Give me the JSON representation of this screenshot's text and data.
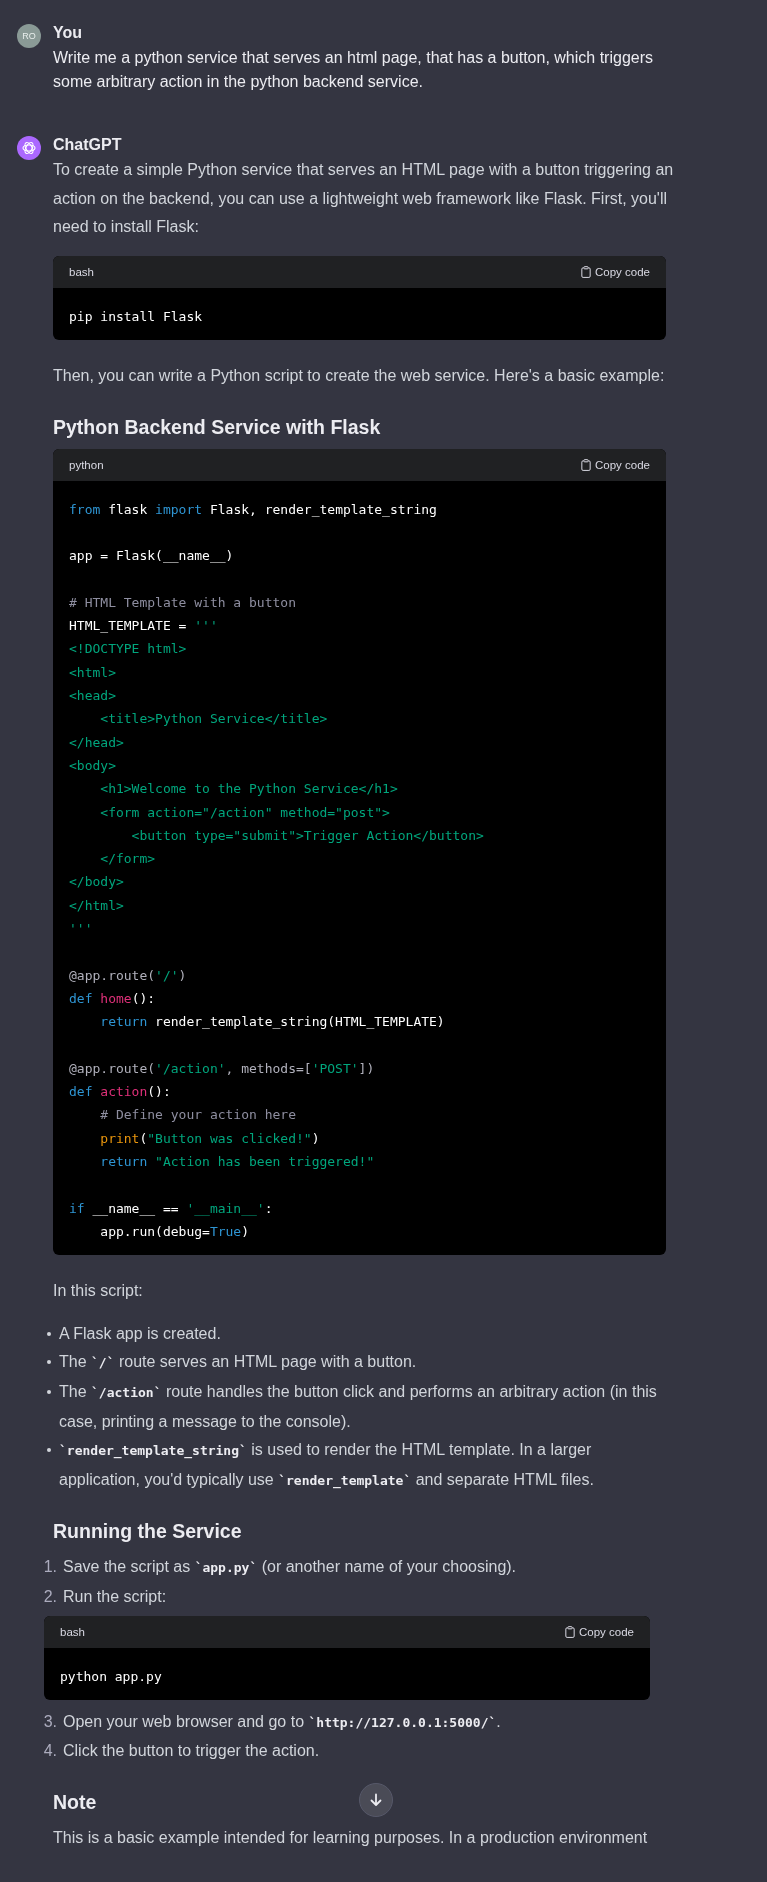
{
  "messages": [
    {
      "kind": "user",
      "author": "You",
      "avatar": "RO",
      "blocks": [
        {
          "kind": "paragraph",
          "segments": [
            {
              "text": "Write me a python service that serves an html page, that has a button, which triggers some arbitrary action in the python backend service."
            }
          ]
        }
      ]
    },
    {
      "kind": "assistant",
      "author": "ChatGPT",
      "blocks": [
        {
          "kind": "paragraph",
          "segments": [
            {
              "text": "To create a simple Python service that serves an HTML page with a button triggering an action on the backend, you can use a lightweight web framework like Flask. First, you'll need to install Flask:"
            }
          ]
        },
        {
          "kind": "code",
          "language": "bash",
          "copy_label": "Copy code",
          "groups": [
            [
              [
                {
                  "kind": "plain",
                  "text": "pip install Flask"
                }
              ]
            ]
          ]
        },
        {
          "kind": "paragraph",
          "segments": [
            {
              "text": "Then, you can write a Python script to create the web service. Here's a basic example:"
            }
          ]
        },
        {
          "kind": "heading",
          "text": "Python Backend Service with Flask"
        },
        {
          "kind": "code",
          "language": "python",
          "copy_label": "Copy code",
          "groups": [
            [
              [
                {
                  "kind": "keyword",
                  "text": "from"
                },
                {
                  "kind": "plain",
                  "text": " flask "
                },
                {
                  "kind": "keyword",
                  "text": "import"
                },
                {
                  "kind": "plain",
                  "text": " Flask, render_template_string"
                }
              ]
            ],
            [
              [
                {
                  "kind": "plain",
                  "text": "app = Flask(__name__)"
                }
              ]
            ],
            [
              [
                {
                  "kind": "comment",
                  "text": "# HTML Template with a button"
                }
              ],
              [
                {
                  "kind": "plain",
                  "text": "HTML_TEMPLATE = "
                },
                {
                  "kind": "string",
                  "text": "'''"
                }
              ],
              [
                {
                  "kind": "string",
                  "text": "<!DOCTYPE html>"
                }
              ],
              [
                {
                  "kind": "string",
                  "text": "<html>"
                }
              ],
              [
                {
                  "kind": "string",
                  "text": "<head>"
                }
              ],
              [
                {
                  "kind": "string",
                  "text": "    <title>Python Service</title>"
                }
              ],
              [
                {
                  "kind": "string",
                  "text": "</head>"
                }
              ],
              [
                {
                  "kind": "string",
                  "text": "<body>"
                }
              ],
              [
                {
                  "kind": "string",
                  "text": "    <h1>Welcome to the Python Service</h1>"
                }
              ],
              [
                {
                  "kind": "string",
                  "text": "    <form action=\"/action\" method=\"post\">"
                }
              ],
              [
                {
                  "kind": "string",
                  "text": "        <button type=\"submit\">Trigger Action</button>"
                }
              ],
              [
                {
                  "kind": "string",
                  "text": "    </form>"
                }
              ],
              [
                {
                  "kind": "string",
                  "text": "</body>"
                }
              ],
              [
                {
                  "kind": "string",
                  "text": "</html>"
                }
              ],
              [
                {
                  "kind": "string",
                  "text": "'''"
                }
              ]
            ],
            [
              [
                {
                  "kind": "decorator",
                  "text": "@app.route("
                },
                {
                  "kind": "string",
                  "text": "'/'"
                },
                {
                  "kind": "decorator",
                  "text": ")"
                }
              ],
              [
                {
                  "kind": "keyword",
                  "text": "def "
                },
                {
                  "kind": "function",
                  "text": "home"
                },
                {
                  "kind": "plain",
                  "text": "():"
                }
              ],
              [
                {
                  "kind": "keyword",
                  "text": "    return"
                },
                {
                  "kind": "plain",
                  "text": " render_template_string(HTML_TEMPLATE)"
                }
              ]
            ],
            [
              [
                {
                  "kind": "decorator",
                  "text": "@app.route("
                },
                {
                  "kind": "string",
                  "text": "'/action'"
                },
                {
                  "kind": "decorator",
                  "text": ", methods=["
                },
                {
                  "kind": "string",
                  "text": "'POST'"
                },
                {
                  "kind": "decorator",
                  "text": "])"
                }
              ],
              [
                {
                  "kind": "keyword",
                  "text": "def "
                },
                {
                  "kind": "function",
                  "text": "action"
                },
                {
                  "kind": "plain",
                  "text": "():"
                }
              ],
              [
                {
                  "kind": "comment",
                  "text": "    # Define your action here"
                }
              ],
              [
                {
                  "kind": "builtin",
                  "text": "    print"
                },
                {
                  "kind": "plain",
                  "text": "("
                },
                {
                  "kind": "string",
                  "text": "\"Button was clicked!\""
                },
                {
                  "kind": "plain",
                  "text": ")"
                }
              ],
              [
                {
                  "kind": "keyword",
                  "text": "    return "
                },
                {
                  "kind": "string",
                  "text": "\"Action has been triggered!\""
                }
              ]
            ],
            [
              [
                {
                  "kind": "keyword",
                  "text": "if"
                },
                {
                  "kind": "plain",
                  "text": " __name__ == "
                },
                {
                  "kind": "string",
                  "text": "'__main__'"
                },
                {
                  "kind": "plain",
                  "text": ":"
                }
              ],
              [
                {
                  "kind": "plain",
                  "text": "    app.run(debug="
                },
                {
                  "kind": "keyword",
                  "text": "True"
                },
                {
                  "kind": "plain",
                  "text": ")"
                }
              ]
            ]
          ]
        },
        {
          "kind": "paragraph",
          "segments": [
            {
              "text": "In this script:"
            }
          ]
        },
        {
          "kind": "bullets",
          "items": [
            {
              "segments": [
                {
                  "text": "A Flask app is created."
                }
              ]
            },
            {
              "segments": [
                {
                  "text": "The "
                },
                {
                  "text": "`/`",
                  "kind": "code"
                },
                {
                  "text": " route serves an HTML page with a button."
                }
              ]
            },
            {
              "segments": [
                {
                  "text": "The "
                },
                {
                  "text": "`/action`",
                  "kind": "code"
                },
                {
                  "text": " route handles the button click and performs an arbitrary action (in this case, printing a message to the console)."
                }
              ]
            },
            {
              "segments": [
                {
                  "text": "`render_template_string`",
                  "kind": "code"
                },
                {
                  "text": " is used to render the HTML template. In a larger application, you'd typically use "
                },
                {
                  "text": "`render_template`",
                  "kind": "code"
                },
                {
                  "text": " and separate HTML files."
                }
              ]
            }
          ]
        },
        {
          "kind": "heading",
          "text": "Running the Service"
        },
        {
          "kind": "numbered",
          "items": [
            {
              "number": "1.",
              "segments": [
                {
                  "text": "Save the script as "
                },
                {
                  "text": "`app.py`",
                  "kind": "code"
                },
                {
                  "text": " (or another name of your choosing)."
                }
              ]
            },
            {
              "number": "2.",
              "segments": [
                {
                  "text": "Run the script:"
                }
              ],
              "code": {
                "language": "bash",
                "copy_label": "Copy code",
                "groups": [
                  [
                    [
                      {
                        "kind": "plain",
                        "text": "python app.py"
                      }
                    ]
                  ]
                ]
              }
            },
            {
              "number": "3.",
              "segments": [
                {
                  "text": "Open your web browser and go to "
                },
                {
                  "text": "`http://127.0.0.1:5000/`",
                  "kind": "code"
                },
                {
                  "text": "."
                }
              ]
            },
            {
              "number": "4.",
              "segments": [
                {
                  "text": "Click the button to trigger the action."
                }
              ]
            }
          ]
        },
        {
          "kind": "heading",
          "text": "Note"
        },
        {
          "kind": "paragraph",
          "segments": [
            {
              "text": "This is a basic example intended for learning purposes. In a production environment"
            }
          ]
        }
      ]
    }
  ]
}
